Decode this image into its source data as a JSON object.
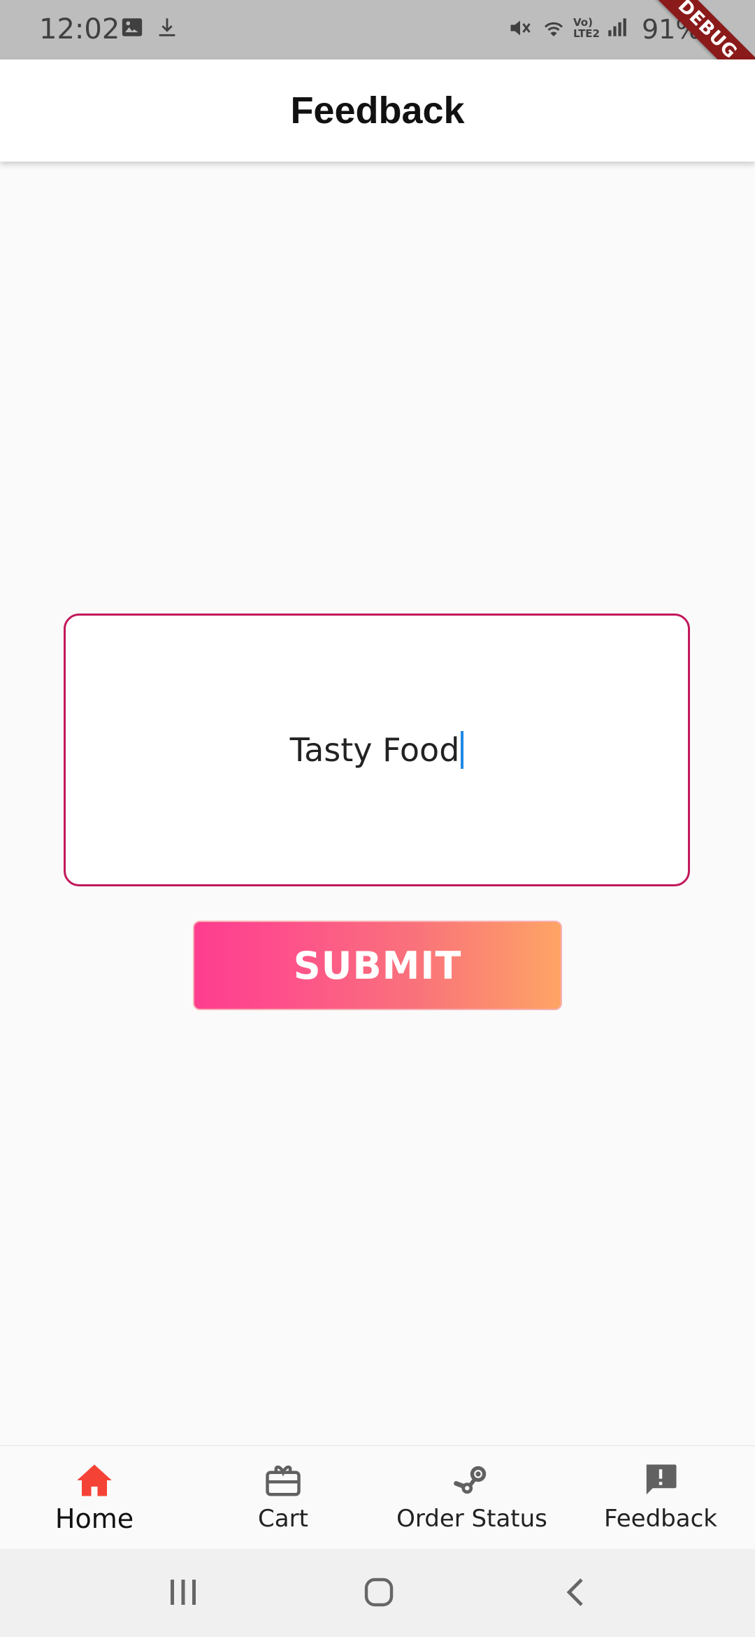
{
  "status_bar": {
    "time": "12:02",
    "battery": "91%",
    "debug_label": "DEBUG"
  },
  "app_bar": {
    "title": "Feedback"
  },
  "feedback": {
    "value": "Tasty Food",
    "border_color": "#c2185b",
    "caret_color": "#1e88e5"
  },
  "submit": {
    "label": "SUBMIT",
    "gradient": [
      "#fe3d8f",
      "#fea465"
    ]
  },
  "bottom_nav": {
    "items": [
      {
        "label": "Home",
        "icon": "home-icon",
        "active": true
      },
      {
        "label": "Cart",
        "icon": "cart-icon",
        "active": false
      },
      {
        "label": "Order Status",
        "icon": "steam-icon",
        "active": false
      },
      {
        "label": "Feedback",
        "icon": "feedback-icon",
        "active": false
      }
    ],
    "active_color": "#f44336"
  },
  "system_nav": {
    "buttons": [
      "recents-icon",
      "home-circle-icon",
      "back-icon"
    ]
  }
}
